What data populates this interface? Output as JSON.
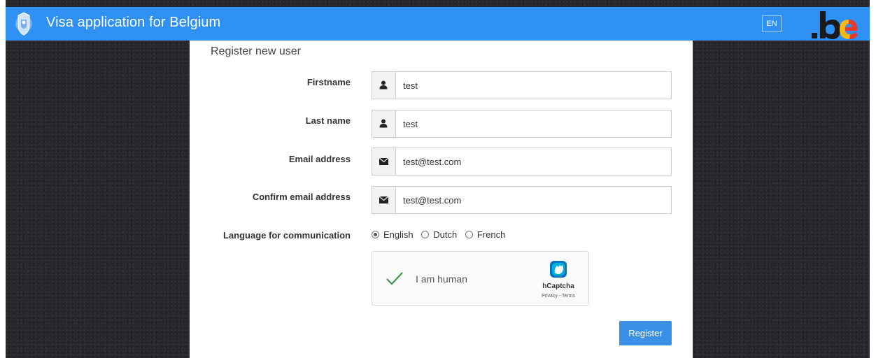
{
  "header": {
    "title": "Visa application for Belgium",
    "language_button": "EN",
    "brand_logo_text": ".be",
    "background_color": "#2f91f3",
    "emblem_icon": "belgian-royal-coat-of-arms"
  },
  "form": {
    "title": "Register new user",
    "fields": [
      {
        "label": "Firstname",
        "value": "test",
        "icon": "user-icon"
      },
      {
        "label": "Last name",
        "value": "test",
        "icon": "user-icon"
      },
      {
        "label": "Email address",
        "value": "test@test.com",
        "icon": "envelope-icon"
      },
      {
        "label": "Confirm email address",
        "value": "test@test.com",
        "icon": "envelope-icon"
      }
    ],
    "language": {
      "label": "Language for communication",
      "options": [
        "English",
        "Dutch",
        "French"
      ],
      "selected": "English"
    },
    "captcha": {
      "text": "I am human",
      "brand": "hCaptcha",
      "links": "Privacy - Terms",
      "checked": true,
      "check_color": "#3c9a4a"
    },
    "submit_label": "Register",
    "submit_color": "#3a8fe6"
  }
}
